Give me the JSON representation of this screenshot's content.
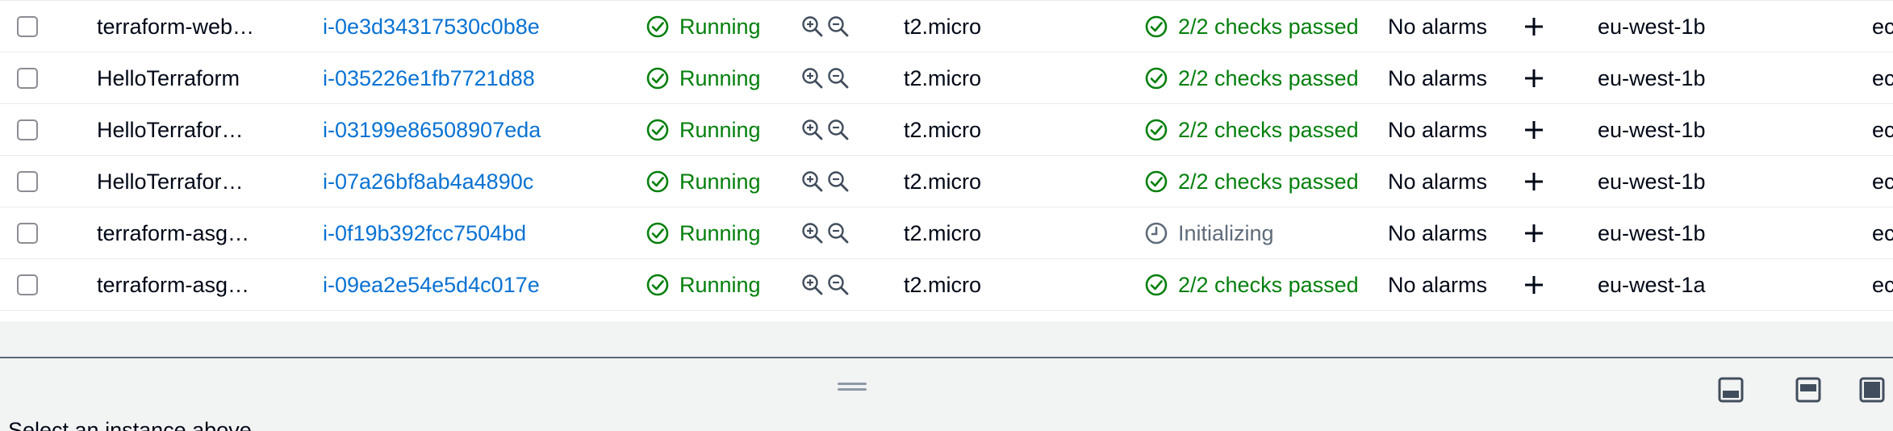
{
  "table": {
    "rows": [
      {
        "name": "terraform-web…",
        "instance_id": "i-0e3d34317530c0b8e",
        "state": "Running",
        "type": "t2.micro",
        "status_check": "2/2 checks passed",
        "status_kind": "ok",
        "alarms": "No alarms",
        "az": "eu-west-1b",
        "extra": "ec"
      },
      {
        "name": "HelloTerraform",
        "instance_id": "i-035226e1fb7721d88",
        "state": "Running",
        "type": "t2.micro",
        "status_check": "2/2 checks passed",
        "status_kind": "ok",
        "alarms": "No alarms",
        "az": "eu-west-1b",
        "extra": "ec"
      },
      {
        "name": "HelloTerrafor…",
        "instance_id": "i-03199e86508907eda",
        "state": "Running",
        "type": "t2.micro",
        "status_check": "2/2 checks passed",
        "status_kind": "ok",
        "alarms": "No alarms",
        "az": "eu-west-1b",
        "extra": "ec"
      },
      {
        "name": "HelloTerrafor…",
        "instance_id": "i-07a26bf8ab4a4890c",
        "state": "Running",
        "type": "t2.micro",
        "status_check": "2/2 checks passed",
        "status_kind": "ok",
        "alarms": "No alarms",
        "az": "eu-west-1b",
        "extra": "ec"
      },
      {
        "name": "terraform-asg…",
        "instance_id": "i-0f19b392fcc7504bd",
        "state": "Running",
        "type": "t2.micro",
        "status_check": "Initializing",
        "status_kind": "init",
        "alarms": "No alarms",
        "az": "eu-west-1b",
        "extra": "ec"
      },
      {
        "name": "terraform-asg…",
        "instance_id": "i-09ea2e54e5d4c017e",
        "state": "Running",
        "type": "t2.micro",
        "status_check": "2/2 checks passed",
        "status_kind": "ok",
        "alarms": "No alarms",
        "az": "eu-west-1a",
        "extra": "ec"
      }
    ]
  },
  "colors": {
    "link": "#0972d3",
    "success": "#037f0c",
    "pending": "#5f6b7a"
  },
  "icons": {
    "state": "check-circle-icon",
    "zoom_in": "zoom-in-icon",
    "zoom_out": "zoom-out-icon",
    "status_ok": "check-circle-icon",
    "status_init": "clock-icon",
    "add_alarm": "plus-icon"
  },
  "split_panel": {
    "message": "Select an instance above",
    "position_buttons": [
      "panel-bottom-icon",
      "panel-side-icon",
      "panel-fullscreen-icon"
    ]
  }
}
